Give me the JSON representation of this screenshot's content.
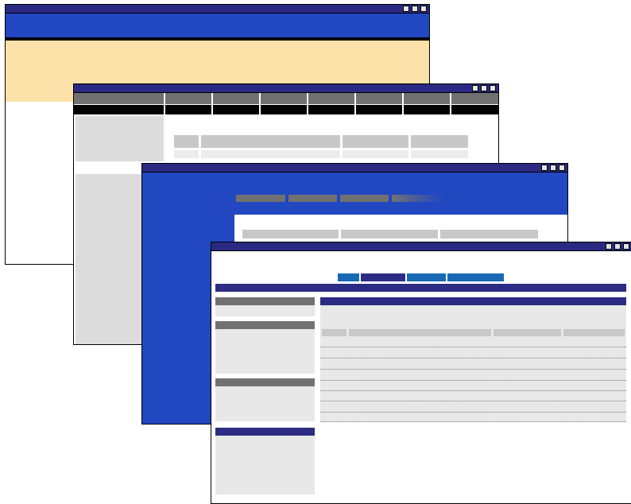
{
  "colors": {
    "title_bar": "#2a2a82",
    "blue": "#2147c1",
    "peach": "#fce2a8",
    "light_gray": "#dcdcdc",
    "mid_gray": "#c8c8c8",
    "dark_gray": "#717171",
    "black": "#000000",
    "navy": "#2c2c84",
    "tab_blue": "#1769b4"
  },
  "icons": [
    "minimize-icon",
    "maximize-icon",
    "close-icon"
  ],
  "windows": [
    {
      "name": "window-1",
      "layers": [
        "blue-header",
        "peach-banner"
      ]
    },
    {
      "name": "window-2",
      "layers": [
        "gray-menubar",
        "black-toolbar",
        "sidebar",
        "table-header"
      ]
    },
    {
      "name": "window-3",
      "layers": [
        "blue-sidebar",
        "gray-tabs",
        "table-header"
      ]
    },
    {
      "name": "window-4",
      "layers": [
        "tab-strip",
        "navy-bar",
        "sidebar-panels",
        "content-panel",
        "dotted-table"
      ]
    }
  ]
}
